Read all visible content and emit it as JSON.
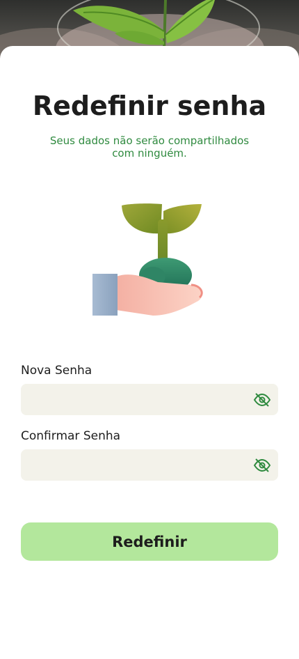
{
  "header": {
    "title": "Redefinir senha",
    "subtitle": "Seus dados não serão compartilhados com ninguém."
  },
  "form": {
    "new_password": {
      "label": "Nova Senha",
      "value": "",
      "placeholder": "",
      "toggle_icon": "eye-off-icon"
    },
    "confirm_password": {
      "label": "Confirmar Senha",
      "value": "",
      "placeholder": "",
      "toggle_icon": "eye-off-icon"
    },
    "submit_label": "Redefinir"
  },
  "illustration": {
    "icon": "hand-holding-plant-icon"
  },
  "colors": {
    "accent": "#2f8a3f",
    "button": "#b3e79c",
    "input_bg": "#f3f2ea",
    "text": "#1d1d1d"
  }
}
